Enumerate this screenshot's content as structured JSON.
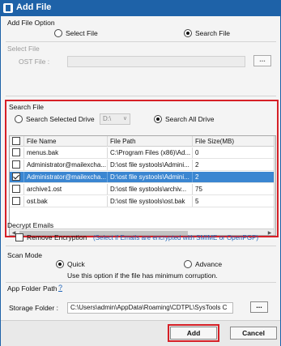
{
  "window": {
    "title": "Add File"
  },
  "add_file_option": {
    "label": "Add File Option",
    "select_file": "Select File",
    "search_file": "Search File",
    "selected": "search_file"
  },
  "select_file_group": {
    "label": "Select File",
    "ost_file_label": "OST File :",
    "ost_file_value": "",
    "browse_label": "..."
  },
  "search_file_group": {
    "label": "Search File",
    "search_selected_drive": "Search Selected Drive",
    "drive_value": "D:\\",
    "search_all_drive": "Search All Drive",
    "selected": "search_all_drive"
  },
  "file_table": {
    "columns": [
      "File Name",
      "File Path",
      "File Size(MB)"
    ],
    "header_checked": false,
    "rows": [
      {
        "name": "menus.bak",
        "path": "C:\\Program Files (x86)\\Ad...",
        "size": "0",
        "checked": false,
        "selected": false
      },
      {
        "name": "Administrator@mailexcha...",
        "path": "D:\\ost file systools\\Admini...",
        "size": "2",
        "checked": false,
        "selected": false
      },
      {
        "name": "Administrator@mailexcha...",
        "path": "D:\\ost file systools\\Admini...",
        "size": "2",
        "checked": true,
        "selected": true
      },
      {
        "name": "archive1.ost",
        "path": "D:\\ost file systools\\archiv...",
        "size": "75",
        "checked": false,
        "selected": false
      },
      {
        "name": "ost.bak",
        "path": "D:\\ost file systools\\ost.bak",
        "size": "5",
        "checked": false,
        "selected": false
      }
    ]
  },
  "decrypt_emails": {
    "label": "Decrypt Emails",
    "remove_encryption": "Remove Encryption",
    "remove_encryption_checked": false,
    "hint": "(Select if Emails are encrypted with SMIME or OpenPGP)"
  },
  "scan_mode": {
    "label": "Scan Mode",
    "quick": "Quick",
    "advance": "Advance",
    "selected": "quick",
    "hint": "Use this option if the file has minimum corruption."
  },
  "app_folder": {
    "label": "App Folder Path",
    "help": "?",
    "storage_label": "Storage Folder :",
    "storage_value": "C:\\Users\\admin\\AppData\\Roaming\\CDTPL\\SysTools C",
    "browse_label": "..."
  },
  "footer": {
    "add_label": "Add",
    "cancel_label": "Cancel"
  },
  "colors": {
    "title_bar": "#1e62a8",
    "highlight_border": "#d62027",
    "selected_row": "#3b86d1",
    "hint_text": "#1f64b9"
  }
}
